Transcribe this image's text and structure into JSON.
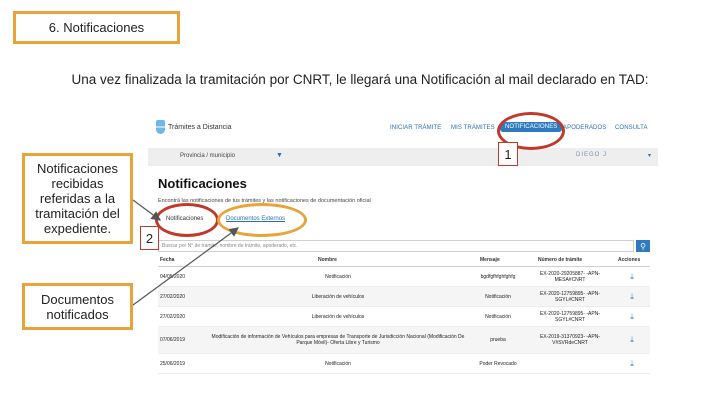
{
  "slide": {
    "section_title": "6. Notificaciones",
    "intro": "Una vez finalizada la tramitación por CNRT, le llegará una Notificación al mail declarado en TAD:",
    "callout_1": "Notificaciones recibidas referidas a la tramitación del expediente.",
    "callout_2": "Documentos notificados",
    "marker_1": "1",
    "marker_2": "2"
  },
  "app": {
    "brand": "Trámites a Distancia",
    "nav": [
      "INICIAR TRÁMITE",
      "MIS TRÁMITES",
      "NOTIFICACIONES",
      "APODERADOS",
      "CONSULTA"
    ],
    "filter_label": "Provincia / municipio",
    "filter_arrow": "▼",
    "user": "DIEGO J",
    "user_arrow": "▾",
    "page_title": "Notificaciones",
    "page_subtitle": "Encontrá las notificaciones de tus trámites y las notificaciones de documentación oficial",
    "tabs": [
      "Notificaciones",
      "Documentos Externos"
    ],
    "search_placeholder": "Buscar por N° de trámite, nombre de trámite, apoderado, etc.",
    "search_icon": "search-icon",
    "columns": [
      "Fecha",
      "Nombre",
      "Mensaje",
      "Número de trámite",
      "Acciones"
    ],
    "rows": [
      {
        "fecha": "04/05/2020",
        "nombre": "Notificación",
        "mensaje": "bgdfgfhfghfghfg",
        "tramite": "EX-2020-29205887- -APN-MESA#CNRT"
      },
      {
        "fecha": "27/02/2020",
        "nombre": "Liberación de vehículos",
        "mensaje": "Notificación",
        "tramite": "EX-2020-12759895- -APN-SGYL#CNRT"
      },
      {
        "fecha": "27/02/2020",
        "nombre": "Liberación de vehículos",
        "mensaje": "Notificación",
        "tramite": "EX-2020-12759895- -APN-SGYL#CNRT"
      },
      {
        "fecha": "07/06/2019",
        "nombre": "Modificación de información de Vehículos para empresas de Transporte de Jurisdicción Nacional (Modificación De Parque Móvil)- Oferta Libre y Turismo",
        "mensaje": "prueba",
        "tramite": "EX-2019-31370923- -APN-V#SVRdeCNRT"
      },
      {
        "fecha": "25/06/2019",
        "nombre": "Notificación",
        "mensaje": "Poder Revocado",
        "tramite": ""
      }
    ]
  },
  "colors": {
    "accent": "#e8a33a",
    "marker": "#c0392b",
    "primary": "#2e7bbf"
  }
}
